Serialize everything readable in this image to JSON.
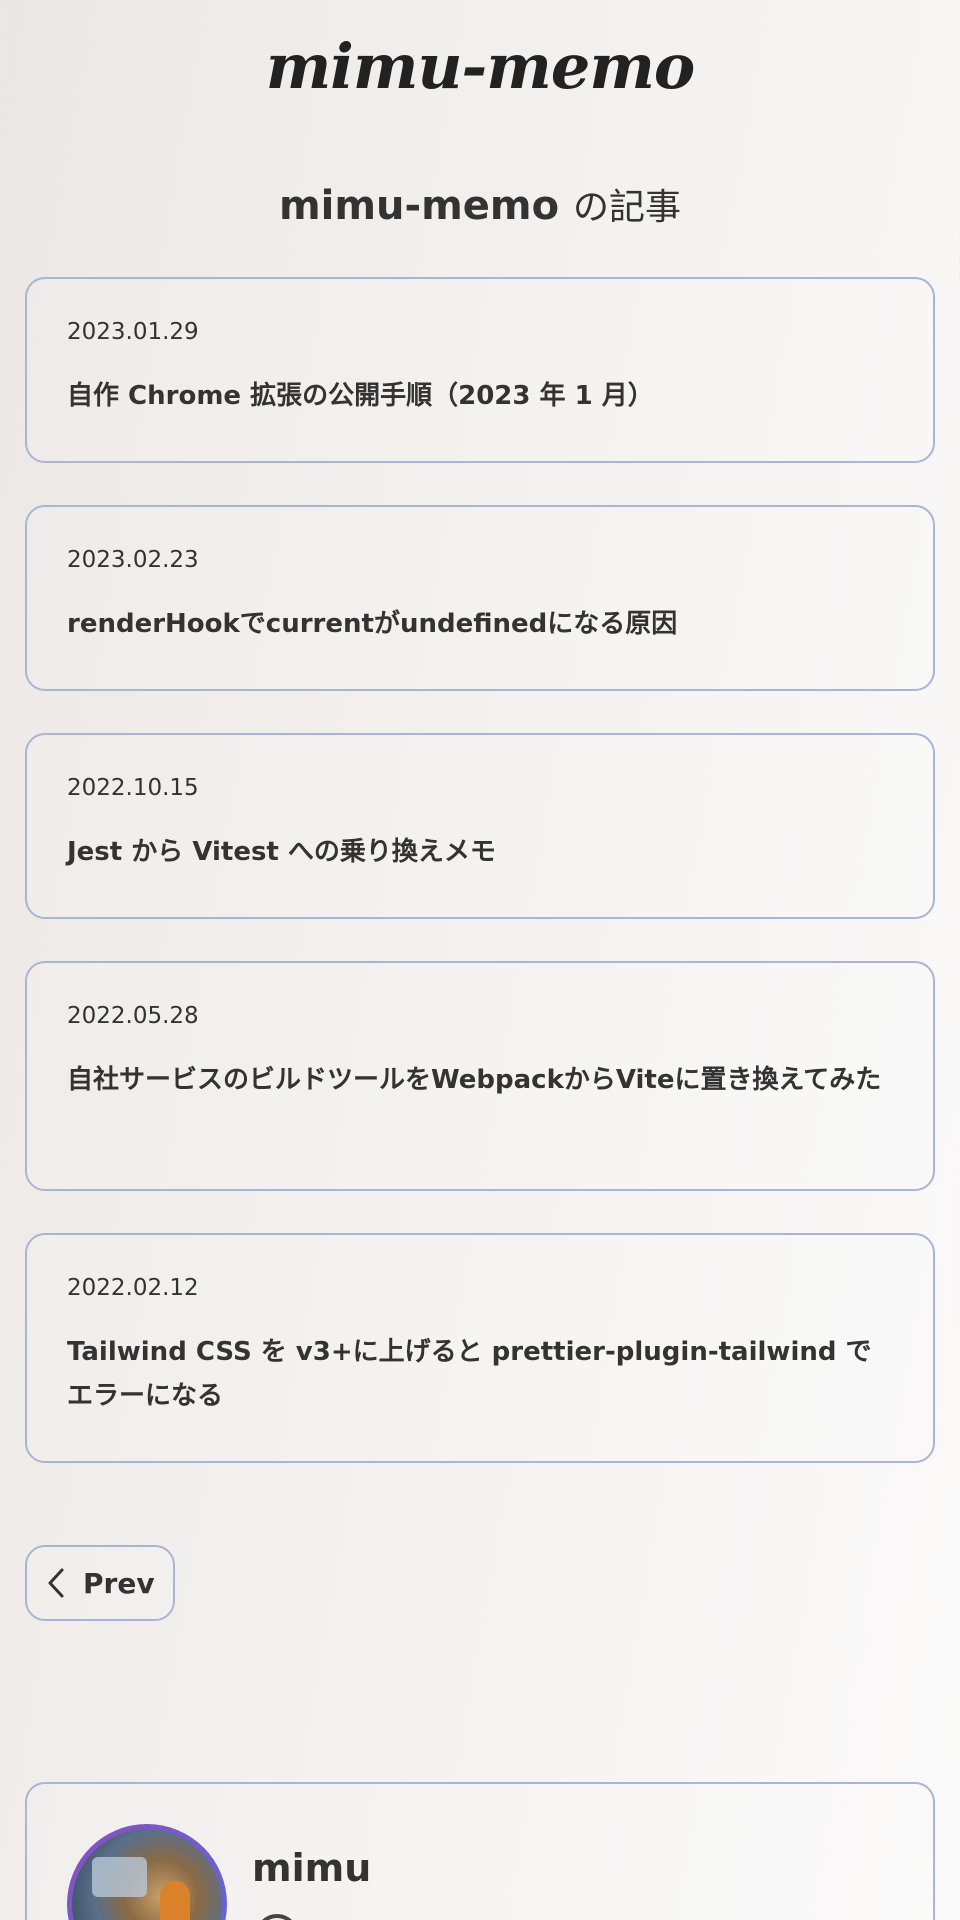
{
  "site": {
    "logo_text": "mimu-memo"
  },
  "heading": {
    "blog_name": "mimu-memo",
    "suffix": "の記事"
  },
  "articles": [
    {
      "date": "2023.01.29",
      "title": "自作 Chrome 拡張の公開手順（2023 年 1 月）"
    },
    {
      "date": "2023.02.23",
      "title": "renderHookでcurrentがundefinedになる原因"
    },
    {
      "date": "2022.10.15",
      "title": "Jest から Vitest への乗り換えメモ"
    },
    {
      "date": "2022.05.28",
      "title": "自社サービスのビルドツールをWebpackからViteに置き換えてみた"
    },
    {
      "date": "2022.02.12",
      "title": "Tailwind CSS を v3+に上げると prettier-plugin-tailwind でエラーになる"
    }
  ],
  "pagination": {
    "prev_label": "Prev",
    "prev_icon": "chevron-left-icon"
  },
  "profile": {
    "name": "mimu",
    "avatar": "avatar-photo"
  },
  "colors": {
    "border": "#a9b4d6",
    "text": "#333333",
    "avatar_ring": "#8a4fc0"
  }
}
